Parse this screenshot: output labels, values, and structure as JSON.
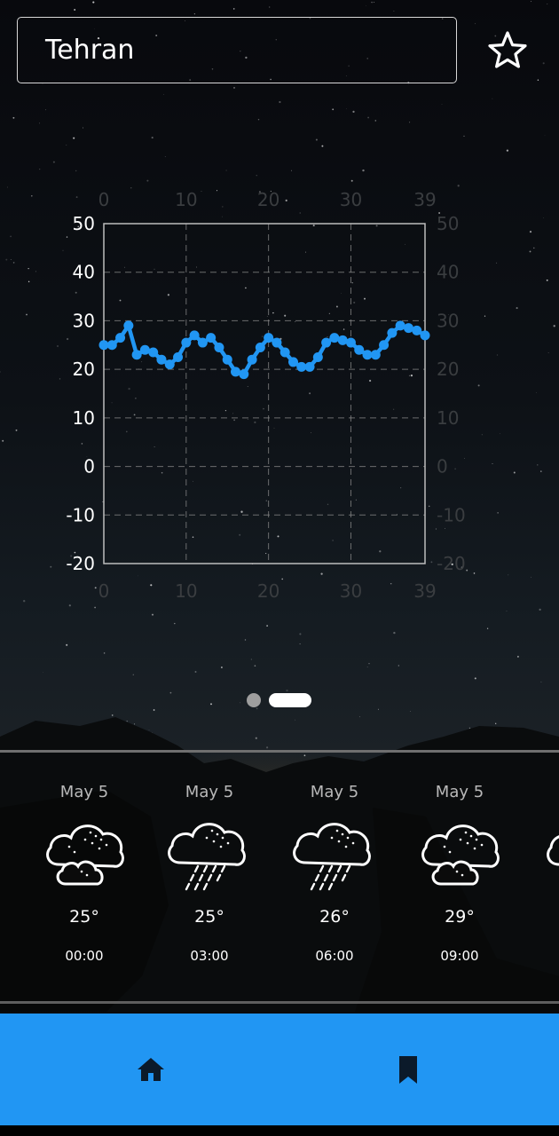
{
  "search": {
    "value": "Tehran"
  },
  "icons": {
    "favorite": "star-outline-icon",
    "home": "home-icon",
    "saved": "bookmark-icon",
    "forecast": [
      "cloudy-icon",
      "rain-icon",
      "rain-icon",
      "cloudy-icon",
      "cloud-icon"
    ]
  },
  "colors": {
    "accent": "#2196f3",
    "series": "#2196f3",
    "nav_icon": "#0b1a2a"
  },
  "chart_data": {
    "type": "line",
    "x": [
      0,
      1,
      2,
      3,
      4,
      5,
      6,
      7,
      8,
      9,
      10,
      11,
      12,
      13,
      14,
      15,
      16,
      17,
      18,
      19,
      20,
      21,
      22,
      23,
      24,
      25,
      26,
      27,
      28,
      29,
      30,
      31,
      32,
      33,
      34,
      35,
      36,
      37,
      38,
      39
    ],
    "values": [
      25,
      25,
      26.5,
      29,
      23,
      24,
      23.5,
      22,
      21,
      22.5,
      25.5,
      27,
      25.5,
      26.5,
      24.5,
      22,
      19.5,
      19,
      22,
      24.5,
      26.5,
      25.5,
      23.5,
      21.5,
      20.5,
      20.5,
      22.5,
      25.5,
      26.5,
      26,
      25.5,
      24,
      23,
      23,
      25,
      27.5,
      29,
      28.5,
      28,
      27
    ],
    "xlim": [
      0,
      39
    ],
    "ylim": [
      -20,
      50
    ],
    "x_ticks": [
      "0",
      "10",
      "20",
      "30",
      "39"
    ],
    "y_ticks": [
      "50",
      "40",
      "30",
      "20",
      "10",
      "0",
      "-10",
      "-20"
    ],
    "grid": true
  },
  "pager": {
    "count": 2,
    "active_index": 1
  },
  "forecast": [
    {
      "date": "May 5",
      "temp": "25°",
      "time": "00:00"
    },
    {
      "date": "May 5",
      "temp": "25°",
      "time": "03:00"
    },
    {
      "date": "May 5",
      "temp": "26°",
      "time": "06:00"
    },
    {
      "date": "May 5",
      "temp": "29°",
      "time": "09:00"
    }
  ]
}
